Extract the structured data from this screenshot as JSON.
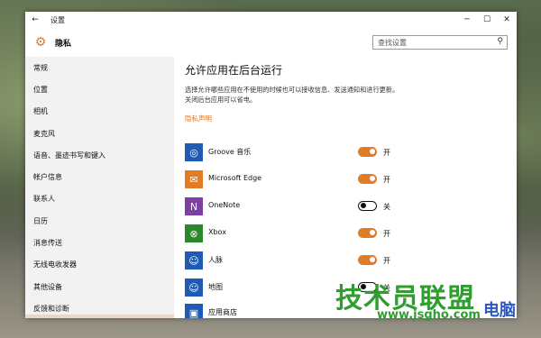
{
  "window": {
    "title": "设置",
    "back_glyph": "←"
  },
  "window_controls": {
    "minimize": "─",
    "maximize": "☐",
    "close": "✕"
  },
  "header": {
    "title": "隐私",
    "search_placeholder": "查找设置"
  },
  "sidebar": {
    "items": [
      {
        "label": "常规"
      },
      {
        "label": "位置"
      },
      {
        "label": "相机"
      },
      {
        "label": "麦克风"
      },
      {
        "label": "语音、墨迹书写和键入"
      },
      {
        "label": "帐户信息"
      },
      {
        "label": "联系人"
      },
      {
        "label": "日历"
      },
      {
        "label": "消息传送"
      },
      {
        "label": "无线电收发器"
      },
      {
        "label": "其他设备"
      },
      {
        "label": "反馈和诊断"
      }
    ]
  },
  "main": {
    "title": "允许应用在后台运行",
    "description": "选择允许哪些应用在不使用的时候也可以接收信息、发送通知和进行更新。关闭后台应用可以省电。",
    "privacy_link": "隐私声明",
    "apps": [
      {
        "name": "Groove 音乐",
        "state": "开",
        "on": true,
        "icon": "music-icon",
        "color": "#1e5bb5",
        "glyph": "◎"
      },
      {
        "name": "Microsoft Edge",
        "state": "开",
        "on": true,
        "icon": "mail-icon",
        "color": "#e07b26",
        "glyph": "✉"
      },
      {
        "name": "OneNote",
        "state": "关",
        "on": false,
        "icon": "onenote-icon",
        "color": "#7b3fa6",
        "glyph": "N"
      },
      {
        "name": "Xbox",
        "state": "开",
        "on": true,
        "icon": "xbox-icon",
        "color": "#2a8a2a",
        "glyph": "⊗"
      },
      {
        "name": "人脉",
        "state": "开",
        "on": true,
        "icon": "people-icon",
        "color": "#1e5bb5",
        "glyph": "☺"
      },
      {
        "name": "地图",
        "state": "关",
        "on": false,
        "icon": "maps-icon",
        "color": "#1e5bb5",
        "glyph": "☺"
      },
      {
        "name": "应用商店",
        "state": "",
        "on": true,
        "icon": "store-icon",
        "color": "#1e5bb5",
        "glyph": "▣"
      }
    ]
  },
  "watermark": {
    "logo": "技术员联盟",
    "url": "www.jsgho.com",
    "cn": "电脑"
  }
}
